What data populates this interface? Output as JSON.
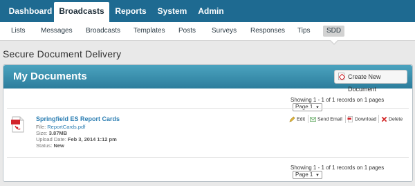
{
  "top_nav": {
    "tabs": [
      {
        "label": "Dashboard"
      },
      {
        "label": "Broadcasts"
      },
      {
        "label": "Reports"
      },
      {
        "label": "System"
      },
      {
        "label": "Admin"
      }
    ],
    "active": "Broadcasts"
  },
  "sub_nav": {
    "items": [
      {
        "label": "Lists"
      },
      {
        "label": "Messages"
      },
      {
        "label": "Broadcasts"
      },
      {
        "label": "Templates"
      },
      {
        "label": "Posts"
      },
      {
        "label": "Surveys"
      },
      {
        "label": "Responses"
      },
      {
        "label": "Tips"
      },
      {
        "label": "SDD"
      }
    ],
    "active": "SDD"
  },
  "page_title": "Secure Document Delivery",
  "panel": {
    "title": "My Documents",
    "create_button": "Create New Document",
    "paging_top": "Showing 1 - 1 of 1 records on 1 pages",
    "paging_bottom": "Showing 1 - 1 of 1 records on 1 pages",
    "page_select": "Page 1"
  },
  "document": {
    "title": "Springfield ES Report Cards",
    "file_label": "File:",
    "file_value": "ReportCards.pdf",
    "size_label": "Size:",
    "size_value": "3.87MB",
    "upload_label": "Upload Date:",
    "upload_value": "Feb 3, 2014 1:12 pm",
    "status_label": "Status:",
    "status_value": "New"
  },
  "actions": {
    "edit": "Edit",
    "send_email": "Send Email",
    "download": "Download",
    "delete": "Delete"
  },
  "colors": {
    "nav_bg": "#1e6a91",
    "panel_header": "#3a8fae",
    "link": "#2a7db2",
    "delete": "#d32b2b"
  }
}
